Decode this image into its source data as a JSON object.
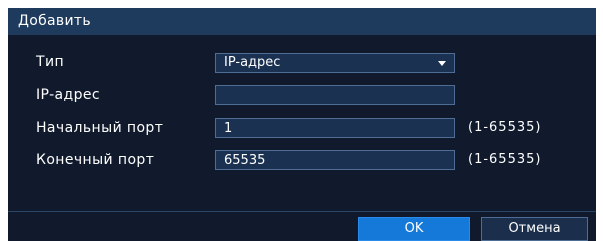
{
  "dialog": {
    "title": "Добавить",
    "fields": {
      "type_label": "Тип",
      "type_value": "IP-адрес",
      "ip_label": "IP-адрес",
      "ip_value": "",
      "start_port_label": "Начальный порт",
      "start_port_value": "1",
      "start_port_range": "(1-65535)",
      "end_port_label": "Конечный порт",
      "end_port_value": "65535",
      "end_port_range": "(1-65535)"
    },
    "buttons": {
      "ok": "OK",
      "cancel": "Отмена"
    }
  },
  "colors": {
    "background": "#101a2c",
    "titlebar": "#1e3a5c",
    "primary_button": "#1479d8"
  },
  "icons": {
    "dropdown": "chevron-down-icon"
  }
}
